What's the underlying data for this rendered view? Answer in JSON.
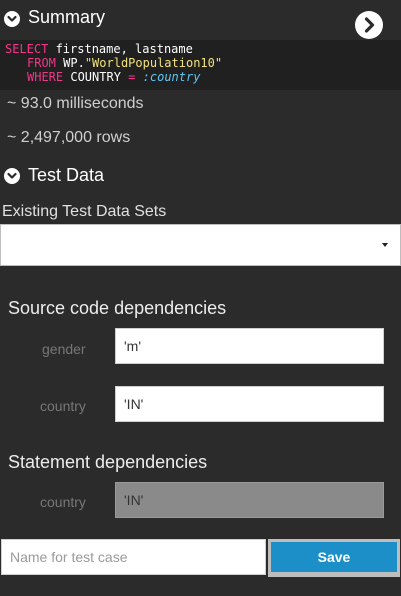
{
  "summary": {
    "title": "Summary",
    "sql": {
      "line1_kw": "SELECT",
      "line1_rest": " firstname, lastname",
      "line2_kw": "FROM",
      "line2_schema": "WP.",
      "line2_table": "\"WorldPopulation10\"",
      "line3_kw": "WHERE",
      "line3_col": "COUNTRY",
      "line3_op": "=",
      "line3_bind": ":country"
    },
    "time": "~ 93.0 milliseconds",
    "rows": "~ 2,497,000 rows"
  },
  "test_data": {
    "title": "Test Data",
    "existing_label": "Existing Test Data Sets",
    "existing_selected": ""
  },
  "source_deps": {
    "title": "Source code dependencies",
    "fields": [
      {
        "label": "gender",
        "value": "'m'"
      },
      {
        "label": "country",
        "value": "'IN'"
      }
    ]
  },
  "statement_deps": {
    "title": "Statement dependencies",
    "fields": [
      {
        "label": "country",
        "value": "'IN'"
      }
    ]
  },
  "footer": {
    "name_placeholder": "Name for test case",
    "save_label": "Save"
  },
  "colors": {
    "background": "#2b2b2b",
    "sql_background": "#202020",
    "keyword": "#f0368a",
    "string": "#f3e27a",
    "bind_variable": "#5fc6f5",
    "save_button": "#1c8fc8"
  },
  "icons": {
    "summary_toggle": "chevron-down-circle-icon",
    "next": "chevron-right-circle-icon",
    "test_data_toggle": "chevron-down-circle-icon",
    "select_caret": "caret-down-icon"
  }
}
